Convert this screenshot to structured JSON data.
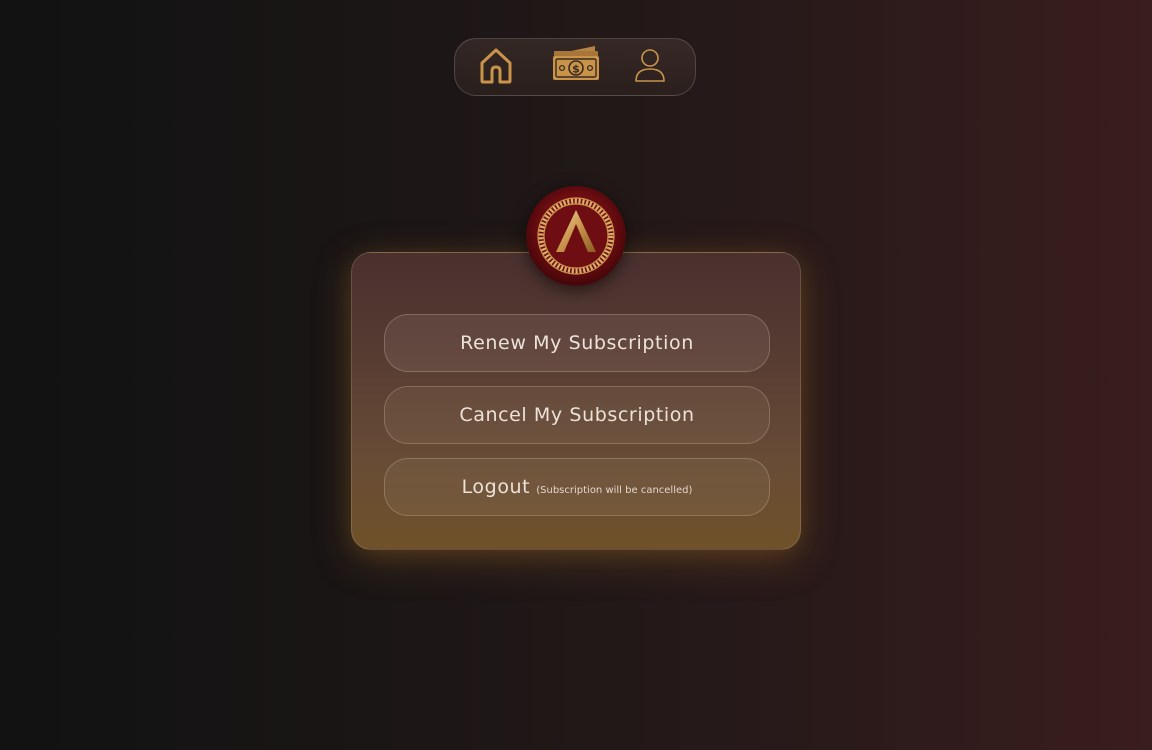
{
  "nav": {
    "items": [
      {
        "icon": "home-icon",
        "label": "Home"
      },
      {
        "icon": "money-icon",
        "label": "Subscription"
      },
      {
        "icon": "profile-icon",
        "label": "Profile"
      }
    ]
  },
  "emblem": {
    "icon": "spartan-lambda-emblem"
  },
  "actions": {
    "renew_label": "Renew My Subscription",
    "cancel_label": "Cancel My Subscription",
    "logout_label": "Logout",
    "logout_note": "(Subscription will be cancelled)"
  },
  "colors": {
    "accent_gold": "#c9944a",
    "emblem_red": "#7a0d12",
    "text": "#ece2d8"
  }
}
